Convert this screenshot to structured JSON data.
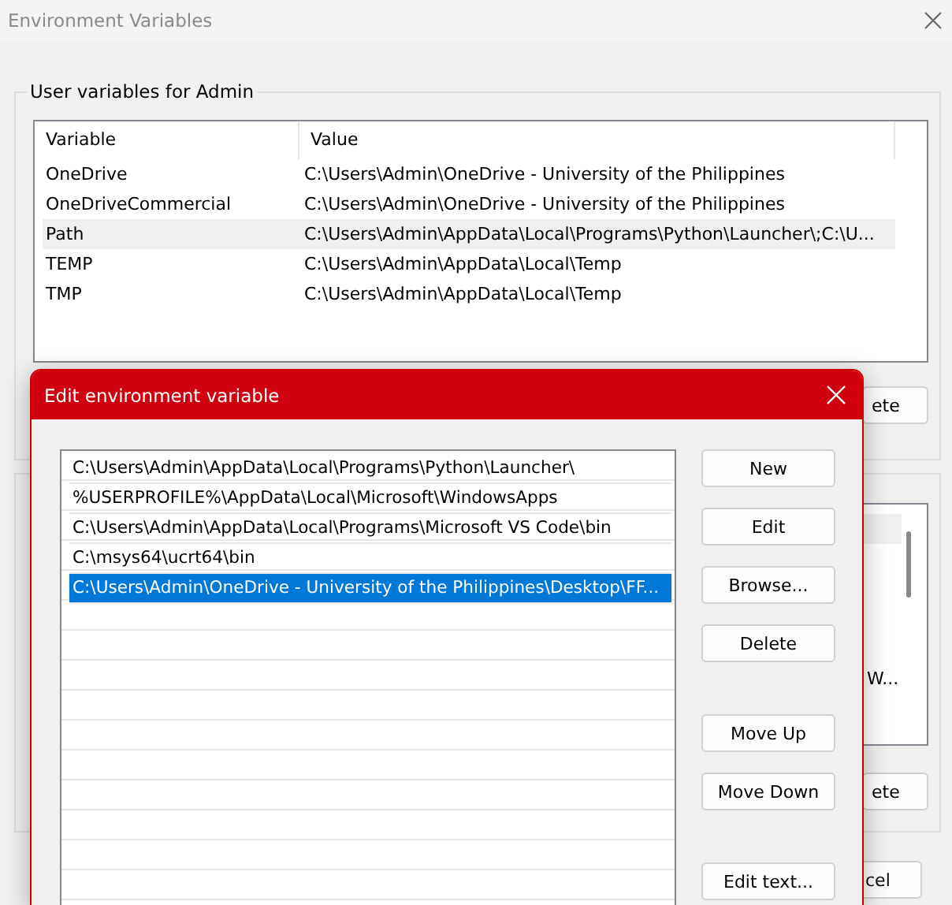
{
  "window": {
    "title": "Environment Variables"
  },
  "user_variables": {
    "title": "User variables for Admin",
    "columns": [
      "Variable",
      "Value"
    ],
    "rows": [
      {
        "variable": "OneDrive",
        "value": "C:\\Users\\Admin\\OneDrive - University of the Philippines",
        "selected": false
      },
      {
        "variable": "OneDriveCommercial",
        "value": "C:\\Users\\Admin\\OneDrive - University of the Philippines",
        "selected": false
      },
      {
        "variable": "Path",
        "value": "C:\\Users\\Admin\\AppData\\Local\\Programs\\Python\\Launcher\\;C:\\U...",
        "selected": true
      },
      {
        "variable": "TEMP",
        "value": "C:\\Users\\Admin\\AppData\\Local\\Temp",
        "selected": false
      },
      {
        "variable": "TMP",
        "value": "C:\\Users\\Admin\\AppData\\Local\\Temp",
        "selected": false
      }
    ],
    "button": "ete"
  },
  "system_variables": {
    "rows": [
      {
        "selected": true
      },
      {
        "selected": false
      },
      {
        "selected": false
      },
      {
        "selected": false
      },
      {
        "selected": false
      },
      {
        "selected": false,
        "text": "W..."
      }
    ],
    "button": "ete"
  },
  "cancel_button": "cel",
  "dialog": {
    "title": "Edit environment variable",
    "entries": [
      {
        "text": "C:\\Users\\Admin\\AppData\\Local\\Programs\\Python\\Launcher\\",
        "selected": false
      },
      {
        "text": "%USERPROFILE%\\AppData\\Local\\Microsoft\\WindowsApps",
        "selected": false
      },
      {
        "text": "C:\\Users\\Admin\\AppData\\Local\\Programs\\Microsoft VS Code\\bin",
        "selected": false
      },
      {
        "text": "C:\\msys64\\ucrt64\\bin",
        "selected": false
      },
      {
        "text": "C:\\Users\\Admin\\OneDrive - University of the Philippines\\Desktop\\FF...",
        "selected": true
      }
    ],
    "button_groups": [
      [
        "New",
        "Edit",
        "Browse...",
        "Delete"
      ],
      [
        "Move Up",
        "Move Down"
      ],
      [
        "Edit text..."
      ]
    ]
  }
}
